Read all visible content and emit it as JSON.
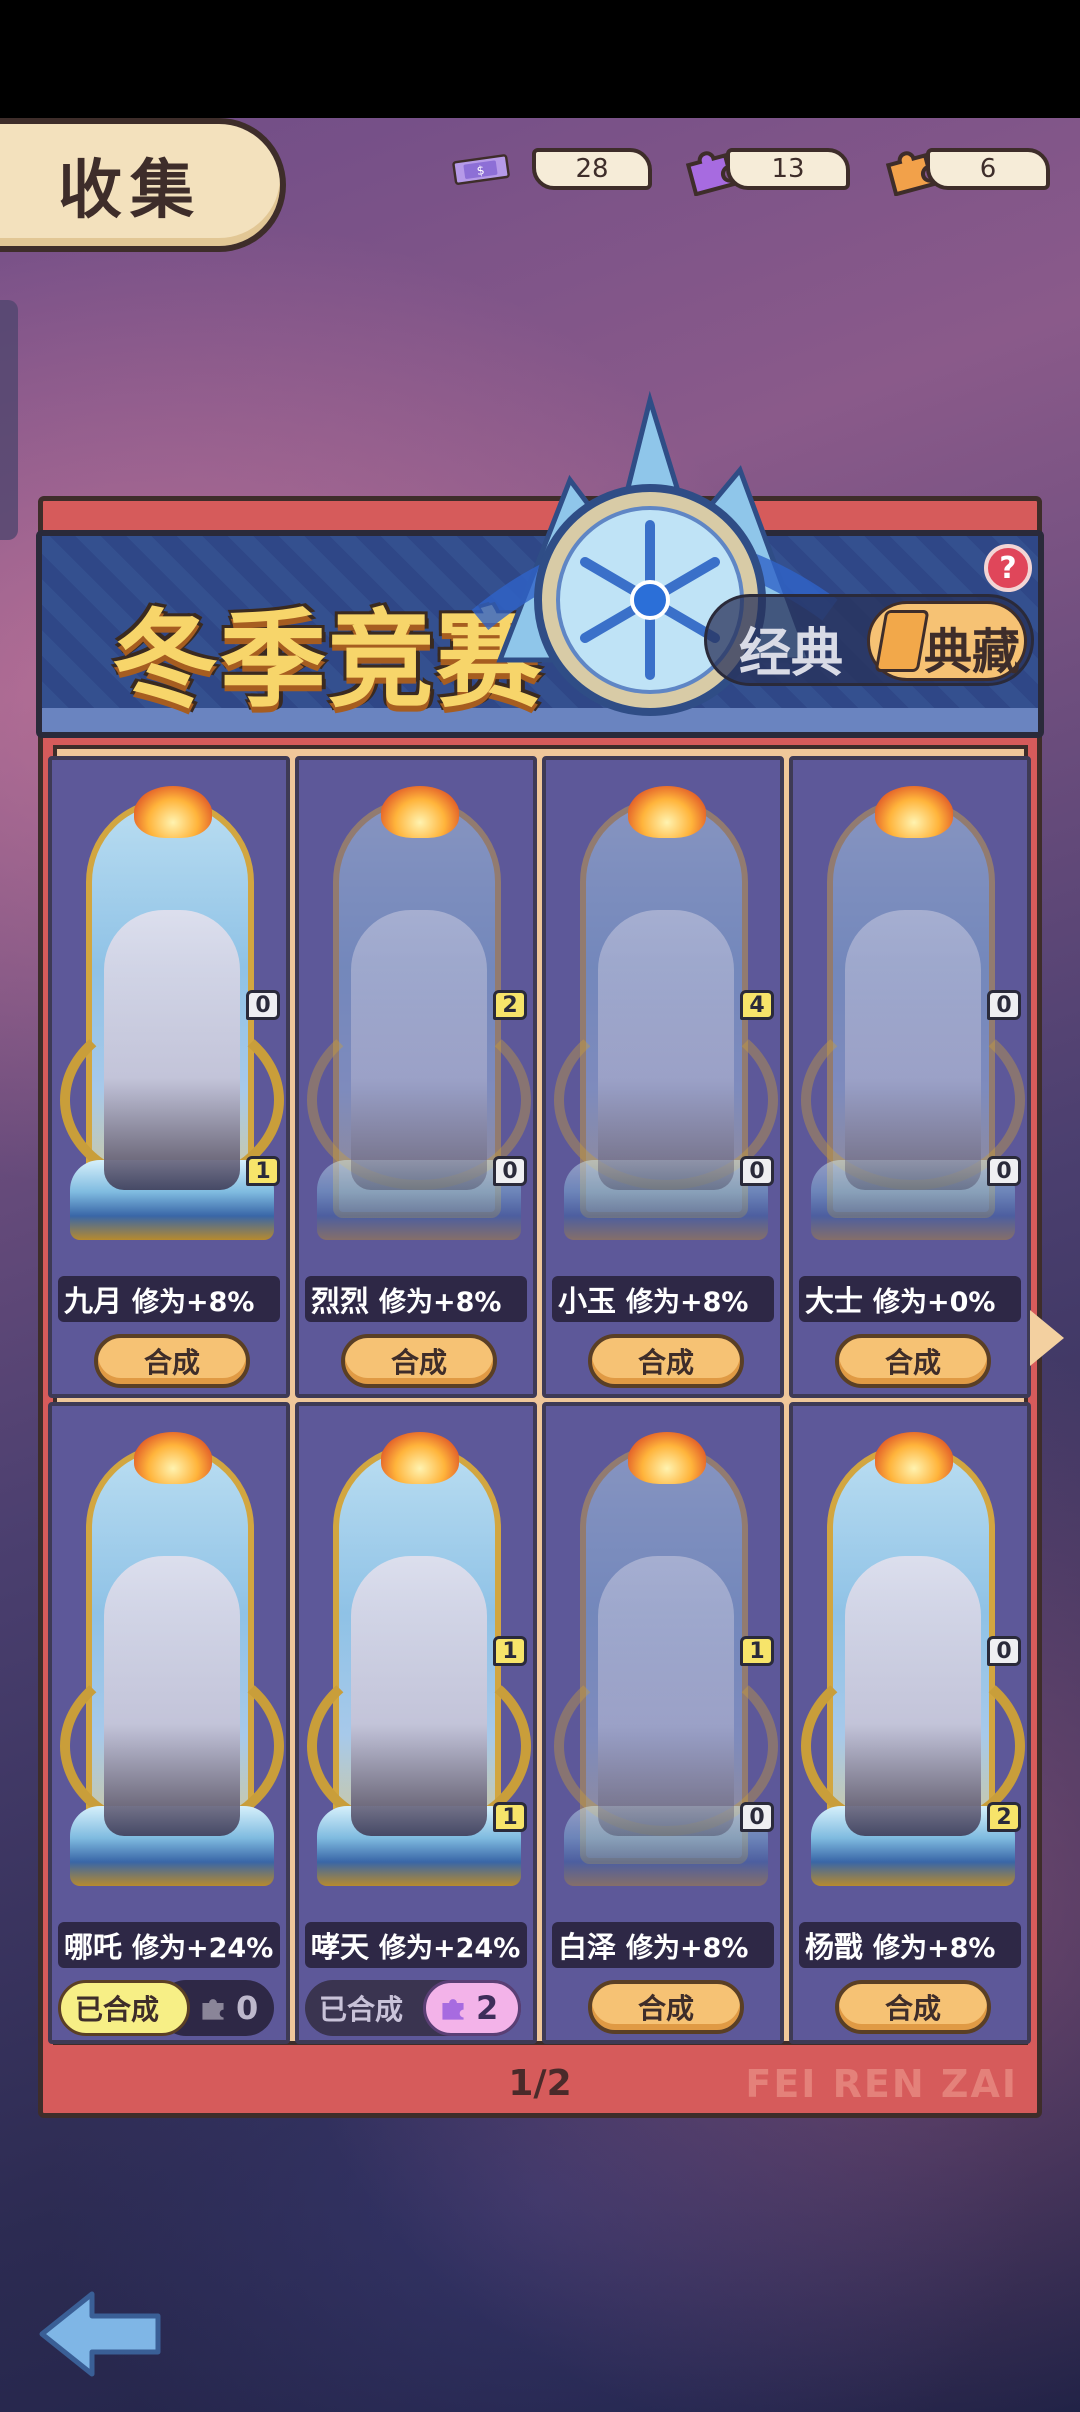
{
  "header": {
    "title": "收集"
  },
  "currencies": [
    {
      "icon": "ticket-icon",
      "value": "28"
    },
    {
      "icon": "purple-puzzle-icon",
      "value": "13"
    },
    {
      "icon": "orange-puzzle-icon",
      "value": "6"
    }
  ],
  "banner": {
    "title": "冬季竞赛",
    "toggle_classic": "经典",
    "toggle_collection": "典藏",
    "help": "?"
  },
  "cards": [
    {
      "name": "九月",
      "bonus": "修为+8%",
      "top_count": "0",
      "bottom_count": "1",
      "action": "合成"
    },
    {
      "name": "烈烈",
      "bonus": "修为+8%",
      "top_count": "2",
      "bottom_count": "0",
      "action": "合成"
    },
    {
      "name": "小玉",
      "bonus": "修为+8%",
      "top_count": "4",
      "bottom_count": "0",
      "action": "合成"
    },
    {
      "name": "大士",
      "bonus": "修为+0%",
      "top_count": "0",
      "bottom_count": "0",
      "action": "合成"
    },
    {
      "name": "哪吒",
      "bonus": "修为+24%",
      "status": "已合成",
      "fragment_count": "0"
    },
    {
      "name": "哮天",
      "bonus": "修为+24%",
      "top_count": "1",
      "bottom_count": "1",
      "status": "已合成",
      "fragment_count": "2"
    },
    {
      "name": "白泽",
      "bonus": "修为+8%",
      "top_count": "1",
      "bottom_count": "0",
      "action": "合成"
    },
    {
      "name": "杨戬",
      "bonus": "修为+8%",
      "top_count": "0",
      "bottom_count": "2",
      "action": "合成"
    }
  ],
  "pagination": {
    "label": "1/2"
  },
  "watermark": "FEI REN ZAI"
}
